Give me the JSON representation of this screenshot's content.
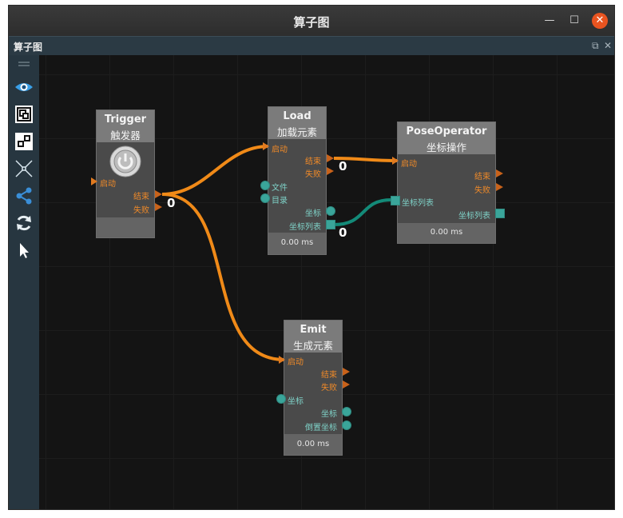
{
  "window": {
    "title": "算子图"
  },
  "panel": {
    "title": "算子图",
    "restore_glyph": "⧉",
    "close_glyph": "✕"
  },
  "toolbar": {
    "tools": [
      "menu-handle-icon",
      "eye-icon",
      "frame-select-icon",
      "connect-nodes-icon",
      "collapse-arrows-icon",
      "graph-share-icon",
      "refresh-icon",
      "pointer-icon"
    ]
  },
  "colors": {
    "exec_wire": "#f08a18",
    "data_wire": "#138a78",
    "canvas": "#141414",
    "node_head": "#7b7b7b",
    "node_body": "#4a4a4a"
  },
  "nodes": {
    "trigger": {
      "name": "Trigger",
      "subtitle": "触发器",
      "ports": {
        "start": "启动",
        "done": "结束",
        "fail": "失败"
      },
      "done_count": "0"
    },
    "load": {
      "name": "Load",
      "subtitle": "加载元素",
      "ports": {
        "start": "启动",
        "done": "结束",
        "fail": "失败",
        "file": "文件",
        "dir": "目录",
        "coord": "坐标",
        "coord_list": "坐标列表"
      },
      "done_count": "0",
      "coord_list_count": "0",
      "time": "0.00 ms"
    },
    "pose": {
      "name": "PoseOperator",
      "subtitle": "坐标操作",
      "ports": {
        "start": "启动",
        "done": "结束",
        "fail": "失败",
        "coord_list_in": "坐标列表",
        "coord_list_out": "坐标列表"
      },
      "time": "0.00 ms"
    },
    "emit": {
      "name": "Emit",
      "subtitle": "生成元素",
      "ports": {
        "start": "启动",
        "done": "结束",
        "fail": "失败",
        "coord_in": "坐标",
        "coord_out": "坐标",
        "inv_coord": "倒置坐标"
      },
      "time": "0.00 ms"
    }
  }
}
